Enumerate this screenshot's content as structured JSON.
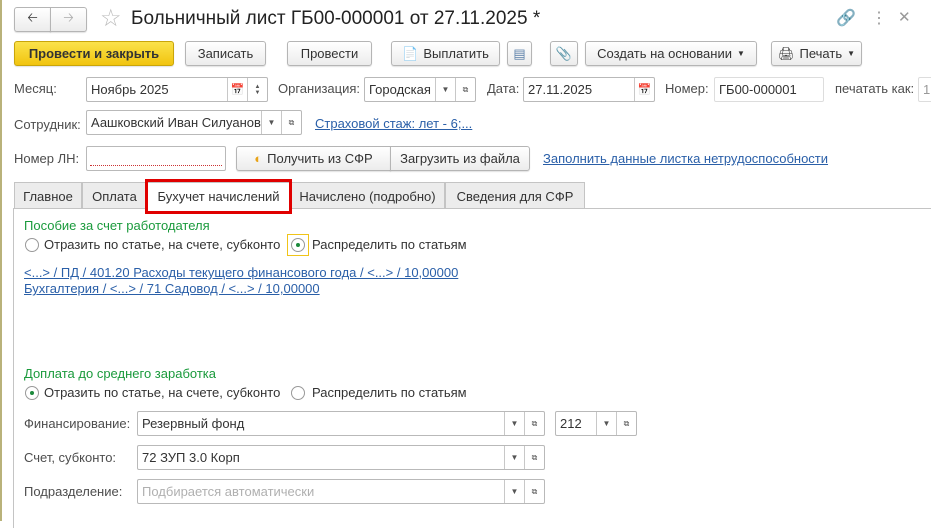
{
  "window": {
    "title": "Больничный лист ГБ00-000001 от 27.11.2025 *"
  },
  "toolbar": {
    "post_close": "Провести и закрыть",
    "save": "Записать",
    "post": "Провести",
    "pay": "Выплатить",
    "create_based": "Создать на основании",
    "print": "Печать"
  },
  "header": {
    "month_label": "Месяц:",
    "month_value": "Ноябрь 2025",
    "org_label": "Организация:",
    "org_value": "Городская",
    "date_label": "Дата:",
    "date_value": "27.11.2025",
    "number_label": "Номер:",
    "number_value": "ГБ00-000001",
    "print_as_label": "печатать как:",
    "print_as_value": "1",
    "employee_label": "Сотрудник:",
    "employee_value": "Аашковский Иван Силуанов",
    "insurance_link": "Страховой стаж: лет - 6;...",
    "ln_label": "Номер ЛН:",
    "ln_value": "",
    "get_sfr": "Получить из СФР",
    "load_file": "Загрузить из файла",
    "fill_link": "Заполнить данные листка нетрудоспособности"
  },
  "tabs": [
    {
      "label": "Главное"
    },
    {
      "label": "Оплата"
    },
    {
      "label": "Бухучет начислений",
      "active": true
    },
    {
      "label": "Начислено (подробно)"
    },
    {
      "label": "Сведения для СФР"
    }
  ],
  "employer": {
    "title": "Пособие за счет работодателя",
    "opt1": "Отразить по статье, на счете, субконто",
    "opt2": "Распределить по статьям",
    "selected": 2,
    "lines": [
      "<...> / ПД / 401.20 Расходы текущего финансового года / <...> / 10,00000",
      "Бухгалтерия / <...> / 71 Садовод / <...> / 10,00000"
    ]
  },
  "topup": {
    "title": "Доплата до среднего заработка",
    "opt1": "Отразить по статье, на счете, субконто",
    "opt2": "Распределить по статьям",
    "selected": 1,
    "financing_label": "Финансирование:",
    "financing_value": "Резервный фонд",
    "kvr_value": "212",
    "account_label": "Счет, субконто:",
    "account_value": "72 ЗУП 3.0 Корп",
    "dept_label": "Подразделение:",
    "dept_placeholder": "Подбирается автоматически"
  },
  "colors": {
    "primary": "#f1c40f",
    "link": "#2a5fa8",
    "section": "#1a9a3c",
    "highlight": "#e00000"
  }
}
